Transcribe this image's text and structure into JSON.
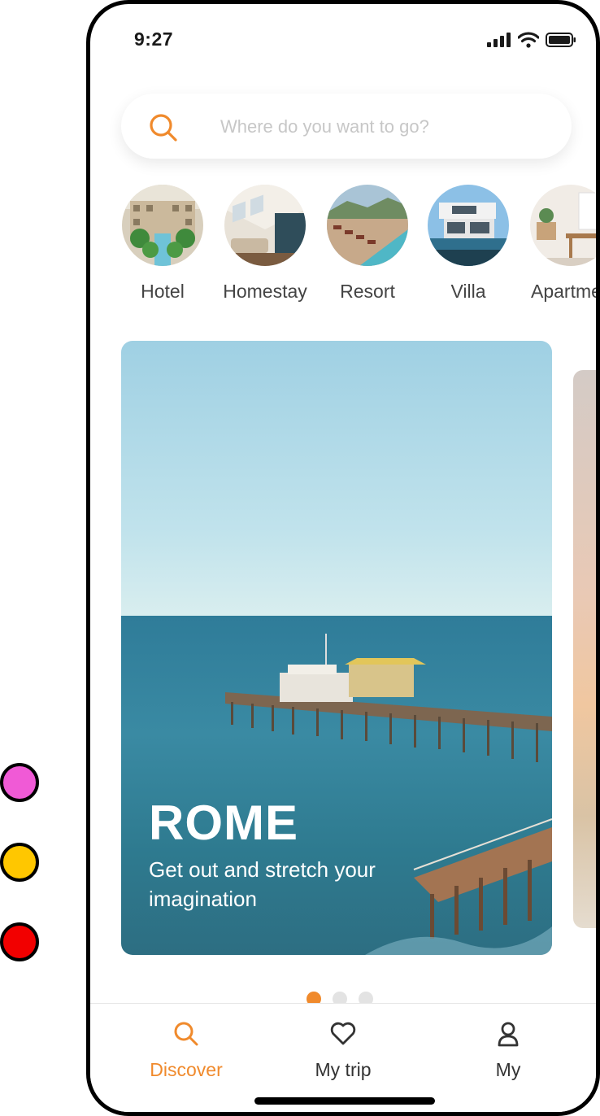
{
  "status_bar": {
    "time": "9:27"
  },
  "search": {
    "placeholder": "Where do you want to go?"
  },
  "categories": [
    {
      "label": "Hotel",
      "image": "hotel-courtyard"
    },
    {
      "label": "Homestay",
      "image": "homestay-room"
    },
    {
      "label": "Resort",
      "image": "resort-pool"
    },
    {
      "label": "Villa",
      "image": "villa-modern"
    },
    {
      "label": "Apartme",
      "image": "apartment-interior"
    }
  ],
  "featured_card": {
    "title": "ROME",
    "subtitle": "Get out and stretch your imagination"
  },
  "pager": {
    "count": 3,
    "active": 1
  },
  "tabbar": {
    "items": [
      {
        "label": "Discover",
        "icon": "search-icon",
        "active": true
      },
      {
        "label": "My trip",
        "icon": "heart-icon",
        "active": false
      },
      {
        "label": "My",
        "icon": "user-icon",
        "active": false
      }
    ]
  },
  "colors": {
    "accent": "#f08a2c",
    "text": "#444444",
    "placeholder": "#c7c7c7",
    "side_dots": [
      "#f05ad6",
      "#ffc700",
      "#f20000"
    ]
  }
}
